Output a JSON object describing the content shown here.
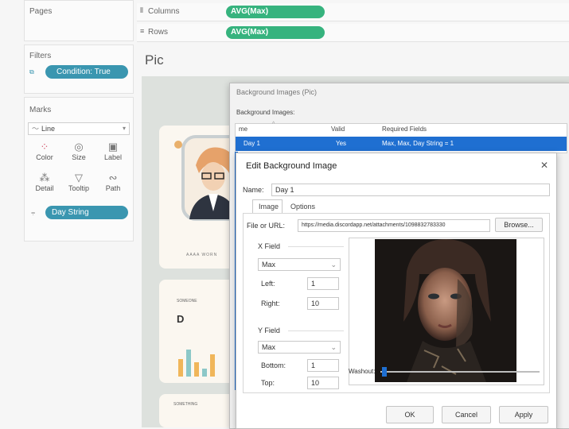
{
  "left": {
    "pages_title": "Pages",
    "filters_title": "Filters",
    "filter_pill": "Condition: True",
    "marks_title": "Marks",
    "mark_type": "Line",
    "mark_buttons": [
      "Color",
      "Size",
      "Label",
      "Detail",
      "Tooltip",
      "Path"
    ],
    "mark_pill": "Day String"
  },
  "shelves": {
    "columns_label": "Columns",
    "columns_pill": "AVG(Max)",
    "rows_label": "Rows",
    "rows_pill": "AVG(Max)"
  },
  "sheet": {
    "title": "Pic",
    "caption": "AAAA WORN",
    "panel_label": "SOMEONE",
    "panel_letter": "D",
    "footer_label": "SOMETHING"
  },
  "bg_dialog": {
    "title": "Background Images (Pic)",
    "section": "Background Images:",
    "headers": [
      "me",
      "Valid",
      "Required Fields"
    ],
    "row": [
      "Day 1",
      "Yes",
      "Max, Max, Day String = 1"
    ]
  },
  "edit_dialog": {
    "title": "Edit Background Image",
    "close": "✕",
    "name_label": "Name:",
    "name_value": "Day 1",
    "tabs": [
      "Image",
      "Options"
    ],
    "file_label": "File or URL:",
    "file_value": "https://media.discordapp.net/attachments/1098832783330",
    "browse": "Browse...",
    "x_field_label": "X Field",
    "x_field_value": "Max",
    "left_label": "Left:",
    "left_value": "1",
    "right_label": "Right:",
    "right_value": "10",
    "y_field_label": "Y Field",
    "y_field_value": "Max",
    "bottom_label": "Bottom:",
    "bottom_value": "1",
    "top_label": "Top:",
    "top_value": "10",
    "washout_label": "Washout:",
    "washout_level": 0.02,
    "ok": "OK",
    "cancel": "Cancel",
    "apply": "Apply"
  },
  "colors": {
    "green_pill": "#36b37e",
    "blue_pill": "#3a96b0",
    "selection": "#1f6fd1"
  }
}
